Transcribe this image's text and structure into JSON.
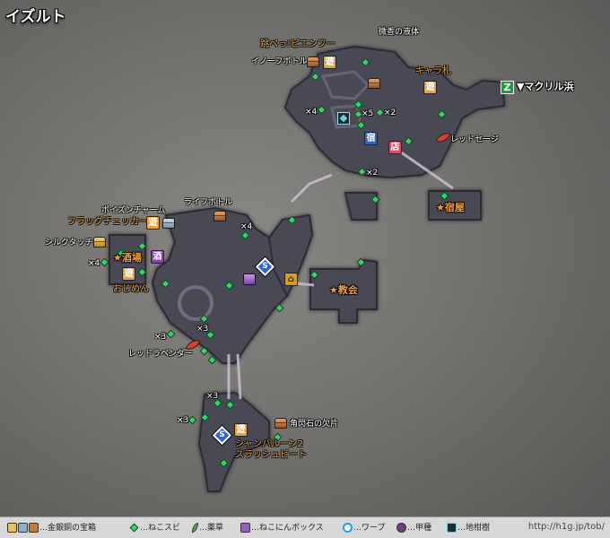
{
  "map": {
    "title": "イズルト",
    "colors": {
      "floor": "#4a4857",
      "floor_edge": "#32303c",
      "bridge": "#bdb3c6",
      "text_white": "#ffffff",
      "text_orange": "#f2a03a",
      "marker_green": "#3bd369"
    }
  },
  "labels": {
    "bikou_no_ekitai": "微香の液体",
    "biro_pien_flute": "跳べっ!ピエンフー",
    "inofu_bottle": "イノーフボトル",
    "chara_fuda": "キャラ札",
    "dest_makuril": "▼マクリル浜",
    "red_sage": "レッドセージ",
    "yadoya": "★宿屋",
    "x4_north": "×4",
    "x5_north": "×5",
    "x2_north": "×2",
    "x2_mid": "×2",
    "life_bottle": "ライフボトル",
    "poison_charm": "ポイズンチャーム",
    "flag_checker": "フラッグチェッカー",
    "silk_touch": "シルクタッチ",
    "x4_west": "×4",
    "x4_mid": "×4",
    "sakaba": "★酒場",
    "ojimen": "おじめん",
    "kyoukai": "★教会",
    "x3_a": "×3",
    "x3_b": "×3",
    "red_lavender": "レッドラベンダー",
    "x3_c": "×3",
    "x3_d": "×3",
    "kakusen_kakera": "角閃石の欠片",
    "shambleen": "シャンバルーン2",
    "slash_beat": "スラッシュビート"
  },
  "icons": {
    "inn_char": "宿",
    "shop_char": "店",
    "bar_char": "酒",
    "play_char": "遊",
    "warp_char": "S",
    "exit_char": "Z"
  },
  "legend": {
    "chest": "…金銀銅の宝箱",
    "nekosubi": "…ねこスビ",
    "herb": "…薬草",
    "nekonin_box": "…ねこにんボックス",
    "warp": "…ワープ",
    "beetle": "…甲種",
    "citrus": "…地柑樹",
    "credit": "http://h1g.jp/tob/"
  }
}
